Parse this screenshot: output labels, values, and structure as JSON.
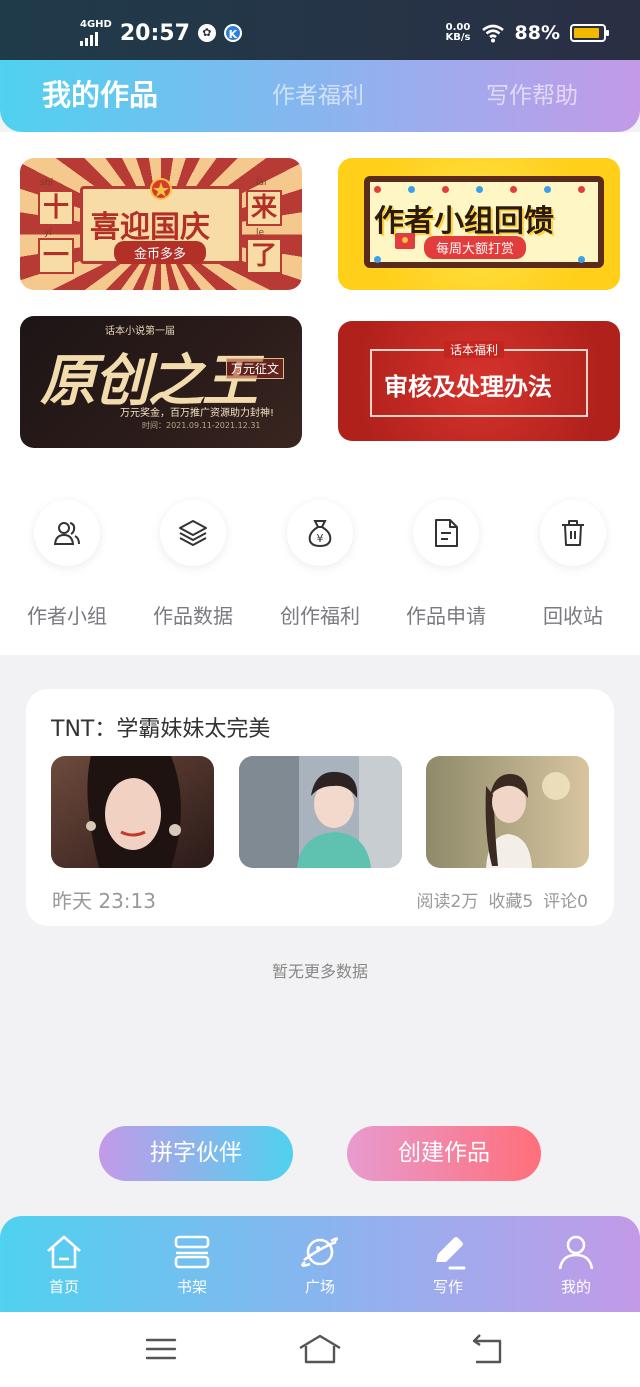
{
  "status": {
    "network": "4GHD",
    "time": "20:57",
    "speed_value": "0.00",
    "speed_unit": "KB/s",
    "battery": "88%",
    "battery_level": 0.88
  },
  "tabs": [
    {
      "label": "我的作品",
      "active": true
    },
    {
      "label": "作者福利",
      "active": false
    },
    {
      "label": "写作帮助",
      "active": false
    }
  ],
  "banners": {
    "national_day": {
      "main": "喜迎国庆",
      "sub": "金币多多",
      "left_top": "十",
      "left_bottom": "一",
      "right_top": "来",
      "right_bottom": "了",
      "pinyin": [
        "shí",
        "yī",
        "lái",
        "le"
      ]
    },
    "author_group": {
      "main": "作者小组回馈",
      "sub": "每周大额打赏"
    },
    "original_king": {
      "top": "话本小说第一届",
      "main": "原创之王",
      "badge": "万元征文",
      "sub": "万元奖金，百万推广资源助力封神!",
      "date": "时间：2021.09.11-2021.12.31"
    },
    "review": {
      "top": "话本福利",
      "main": "审核及处理办法"
    }
  },
  "menu": [
    {
      "label": "作者小组",
      "icon": "author-group-icon"
    },
    {
      "label": "作品数据",
      "icon": "layers-icon"
    },
    {
      "label": "创作福利",
      "icon": "money-bag-icon"
    },
    {
      "label": "作品申请",
      "icon": "document-icon"
    },
    {
      "label": "回收站",
      "icon": "trash-icon"
    }
  ],
  "work": {
    "title": "TNT：学霸妹妹太完美",
    "time": "昨天 23:13",
    "reads": "阅读2万",
    "favorites": "收藏5",
    "comments": "评论0"
  },
  "no_more": "暂无更多数据",
  "actions": {
    "partner": "拼字伙伴",
    "create": "创建作品"
  },
  "nav": [
    {
      "label": "首页",
      "icon": "home-icon"
    },
    {
      "label": "书架",
      "icon": "bookshelf-icon"
    },
    {
      "label": "广场",
      "icon": "planet-icon"
    },
    {
      "label": "写作",
      "icon": "pen-icon"
    },
    {
      "label": "我的",
      "icon": "profile-icon"
    }
  ],
  "colors": {
    "accent_start": "#4fd1ef",
    "accent_end": "#c39ae8",
    "create_button": "#ff6f7a",
    "battery": "#f5b800"
  }
}
